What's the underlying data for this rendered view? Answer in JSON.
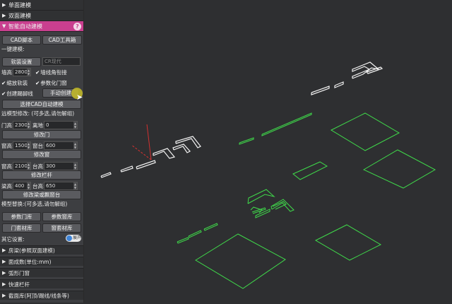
{
  "panel": {
    "sections_top": [
      {
        "label": "单面建模",
        "caret": "▶"
      },
      {
        "label": "双面建模",
        "caret": "▶"
      }
    ],
    "active_section": {
      "label": "智能自动建模",
      "caret": "▼",
      "help": "?"
    },
    "cad_script_button": "CAD脚本",
    "cad_toolbox_button": "CAD工具箱",
    "oneclick_label": "一键建模:",
    "software_settings_button": "软装设置",
    "cr_input_placeholder": "CR现代",
    "wall_height_label": "墙高:",
    "wall_height_value": "2800",
    "check_wall_corner": "墙线角衔接",
    "check_scale_soft": "缩放软装",
    "check_param_door": "参数化门窗",
    "check_create_foot": "创建踢脚线",
    "manual_create_button": "手动创建",
    "select_cad_button": "选择CAD自动建模",
    "remote_modify_label": "远模型修改: (可多选,请勿解组)",
    "door_height_label": "门高:",
    "door_height_value": "2300",
    "door_ground_label": "离地:",
    "door_ground_value": "0",
    "modify_door_button": "修改门",
    "window_height_label": "窗高:",
    "window_height_value": "1500",
    "window_sill_label": "窗台:",
    "window_sill_value": "600",
    "modify_window_button": "修改窗",
    "window_height2_label": "窗高:",
    "window_height2_value": "2100",
    "window_sill2_label": "台高:",
    "window_sill2_value": "300",
    "modify_rail_button": "修改栏杆",
    "beam_height_label": "梁高:",
    "beam_height_value": "400",
    "beam_sill_label": "台高:",
    "beam_sill_value": "650",
    "modify_beam_button": "修改梁或飘窗台",
    "model_replace_label": "模型替换:(可多选,请勿解组)",
    "param_door_lib": "参数门库",
    "param_window_lib": "参数窗库",
    "door_material_lib": "门套材库",
    "window_material_lib": "窗套材库",
    "other_settings_label": "其它设置:",
    "toggle_label": "展开",
    "sections_bottom": [
      {
        "label": "房梁(参照双面建模)",
        "caret": "▶"
      },
      {
        "label": "面成数(单位:mm)",
        "caret": "▶"
      },
      {
        "label": "弧形门窗",
        "caret": "▶"
      },
      {
        "label": "快速栏杆",
        "caret": "▶"
      },
      {
        "label": "截面库(阿顶/踢线/线条等)",
        "caret": "▶"
      }
    ]
  },
  "colors": {
    "accent": "#c93f8f",
    "viewport_bg": "#2e2f31",
    "selected_outline": "#3fd94a",
    "white_outline": "#f2f2f2",
    "axis_red": "#d43030"
  },
  "icons": {
    "cursor": "pointer-arrow-icon",
    "help": "help-icon"
  }
}
